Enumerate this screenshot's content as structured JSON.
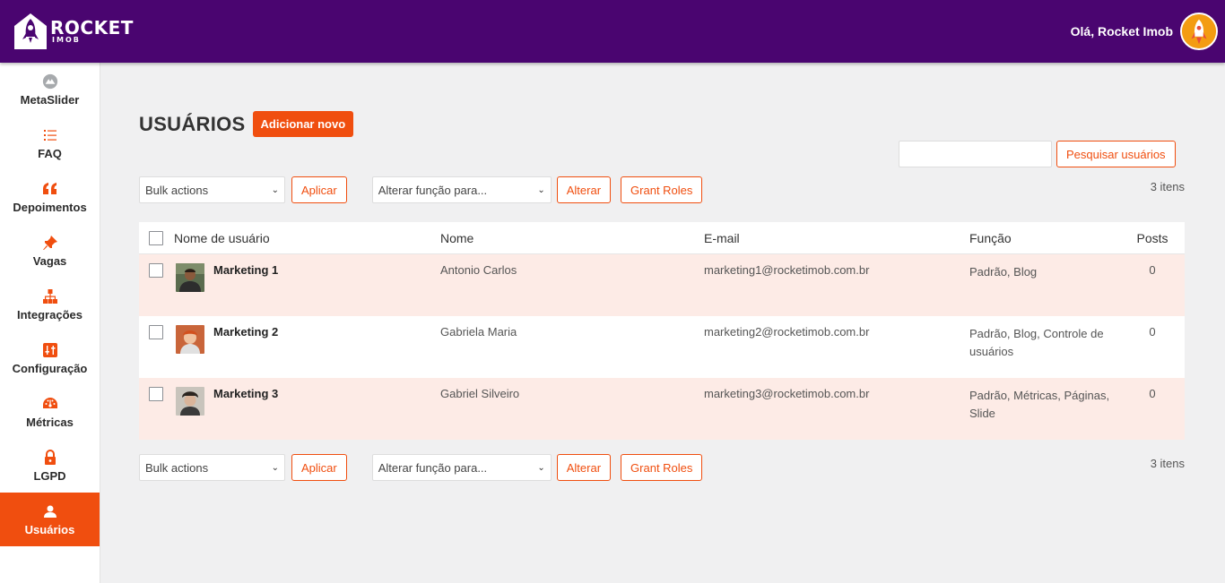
{
  "header": {
    "brand_name": "ROCKET",
    "brand_sub": "IMOB",
    "greeting": "Olá, Rocket Imob"
  },
  "sidebar": {
    "items": [
      {
        "label": "MetaSlider",
        "icon": "metaslider-icon"
      },
      {
        "label": "FAQ",
        "icon": "list-icon"
      },
      {
        "label": "Depoimentos",
        "icon": "quote-icon"
      },
      {
        "label": "Vagas",
        "icon": "pin-icon"
      },
      {
        "label": "Integrações",
        "icon": "network-icon"
      },
      {
        "label": "Configuração",
        "icon": "settings-icon"
      },
      {
        "label": "Métricas",
        "icon": "dashboard-icon"
      },
      {
        "label": "LGPD",
        "icon": "lock-icon"
      },
      {
        "label": "Usuários",
        "icon": "user-icon",
        "active": true
      }
    ]
  },
  "page": {
    "title": "USUÁRIOS",
    "add_new": "Adicionar novo",
    "search_button": "Pesquisar usuários",
    "search_value": ""
  },
  "tablenav": {
    "bulk_actions": "Bulk actions",
    "apply": "Aplicar",
    "change_role": "Alterar função para...",
    "change": "Alterar",
    "grant_roles": "Grant Roles",
    "items_count": "3 itens"
  },
  "table": {
    "columns": {
      "username": "Nome de usuário",
      "name": "Nome",
      "email": "E-mail",
      "role": "Função",
      "posts": "Posts"
    },
    "rows": [
      {
        "username": "Marketing 1",
        "name": "Antonio Carlos",
        "email": "marketing1@rocketimob.com.br",
        "role": "Padrão, Blog",
        "posts": "0"
      },
      {
        "username": "Marketing 2",
        "name": "Gabriela Maria",
        "email": "marketing2@rocketimob.com.br",
        "role": "Padrão, Blog, Controle de usuários",
        "posts": "0"
      },
      {
        "username": "Marketing 3",
        "name": "Gabriel Silveiro",
        "email": "marketing3@rocketimob.com.br",
        "role": "Padrão, Métricas, Páginas, Slide",
        "posts": "0"
      }
    ]
  },
  "colors": {
    "header_bg": "#4a0570",
    "accent": "#f04e0f",
    "row_highlight": "#fdebe6"
  }
}
